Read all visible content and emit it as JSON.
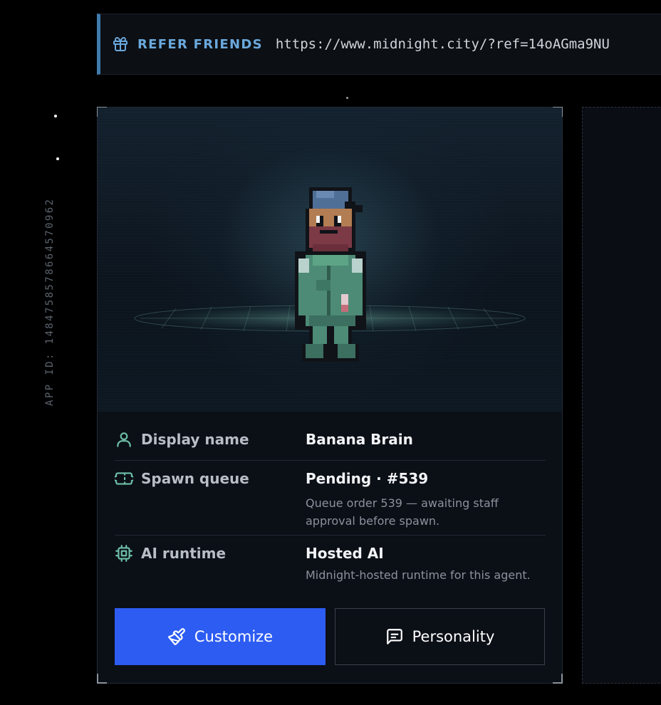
{
  "app_id": {
    "label": "APP ID: 1484758578664570962"
  },
  "refer": {
    "icon": "gift-icon",
    "label": "REFER FRIENDS",
    "url": "https://www.midnight.city/?ref=14oAGma9NU"
  },
  "agent": {
    "rows": [
      {
        "icon": "user-icon",
        "label": "Display name",
        "value": "Banana Brain",
        "description": ""
      },
      {
        "icon": "ticket-icon",
        "label": "Spawn queue",
        "value": "Pending · #539",
        "description": "Queue order 539 — awaiting staff approval before spawn."
      },
      {
        "icon": "cpu-icon",
        "label": "AI runtime",
        "value": "Hosted AI",
        "description": "Midnight-hosted runtime for this agent."
      }
    ],
    "buttons": {
      "customize": {
        "label": "Customize",
        "icon": "paintbrush-icon"
      },
      "personality": {
        "label": "Personality",
        "icon": "message-square-icon"
      }
    }
  },
  "colors": {
    "accent_blue": "#2d5cf2",
    "refer_accent": "#6aa8dc",
    "icon_teal": "#6dbfa8"
  }
}
